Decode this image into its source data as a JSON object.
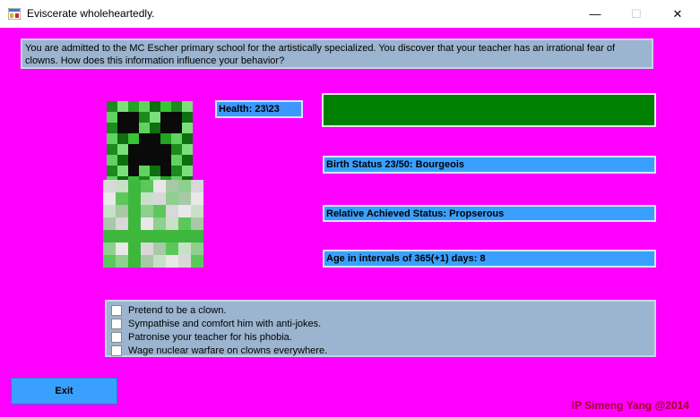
{
  "window": {
    "title": "Eviscerate wholeheartedly.",
    "controls": {
      "minimize": "—",
      "maximize": "☐",
      "close": "✕"
    }
  },
  "question": {
    "text": "You are admitted to the MC Escher primary school for the artistically specialized. You discover that your teacher has an irrational fear of clowns. How does this information influence your behavior?"
  },
  "stats": {
    "health": "Health: 23\\23",
    "health_fraction": 1.0,
    "birth_status": "Birth Status 23/50: Bourgeois",
    "relative_status": "Relative Achieved Status: Propserous",
    "age": "Age in intervals of 365(+1) days: 8"
  },
  "choices": [
    {
      "label": "Pretend to be a clown.",
      "checked": false
    },
    {
      "label": "Sympathise and comfort him with anti-jokes.",
      "checked": false
    },
    {
      "label": "Patronise your teacher for his phobia.",
      "checked": false
    },
    {
      "label": "Wage nuclear warfare on clowns everywhere.",
      "checked": false
    }
  ],
  "buttons": {
    "exit": "Exit"
  },
  "credit": "IP Simeng Yang @2014",
  "colors": {
    "background": "#ff00ff",
    "accent_blue": "#3aa0ff",
    "panel": "#9bb4cf",
    "health_green": "#008000",
    "credit": "#a00028"
  }
}
